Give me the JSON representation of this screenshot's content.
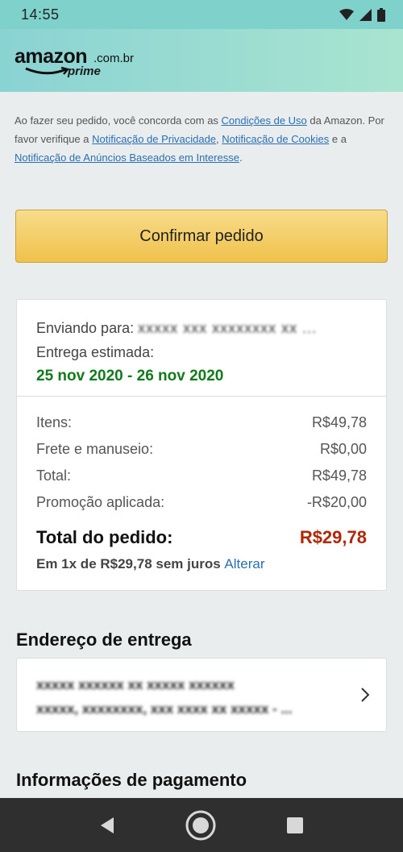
{
  "status_bar": {
    "time": "14:55"
  },
  "header": {
    "logo_main": "amazon",
    "logo_domain": ".com.br",
    "logo_sub": "prime"
  },
  "consent": {
    "text_1": "Ao fazer seu pedido, você concorda com as ",
    "link_terms": "Condições de Uso",
    "text_2": " da Amazon. Por favor verifique a ",
    "link_privacy": "Notificação de Privacidade",
    "text_3": ", ",
    "link_cookies": "Notificação de Cookies",
    "text_4": " e a ",
    "link_ads": "Notificação de Anúncios Baseados em Interesse",
    "text_5": "."
  },
  "confirm_button": "Confirmar pedido",
  "shipping": {
    "label": "Enviando para:",
    "recipient": "xxxxx xxx xxxxxxxx xx ...",
    "estimate_label": "Entrega estimada:",
    "dates": "25 nov 2020 - 26 nov 2020"
  },
  "totals": {
    "rows": [
      {
        "label": "Itens:",
        "value": "R$49,78"
      },
      {
        "label": "Frete e manuseio:",
        "value": "R$0,00"
      },
      {
        "label": "Total:",
        "value": "R$49,78"
      },
      {
        "label": "Promoção aplicada:",
        "value": "-R$20,00"
      }
    ],
    "grand_label": "Total do pedido:",
    "grand_value": "R$29,78",
    "installments": "Em 1x de R$29,78 sem juros",
    "change_link": "Alterar"
  },
  "address_section": {
    "title": "Endereço de entrega",
    "line_1": "xxxxx xxxxxx xx xxxxx xxxxxx",
    "line_2": "xxxxx, xxxxxxxx, xxx xxxx xx xxxxx - ..."
  },
  "payment_section": {
    "title": "Informações de pagamento"
  }
}
